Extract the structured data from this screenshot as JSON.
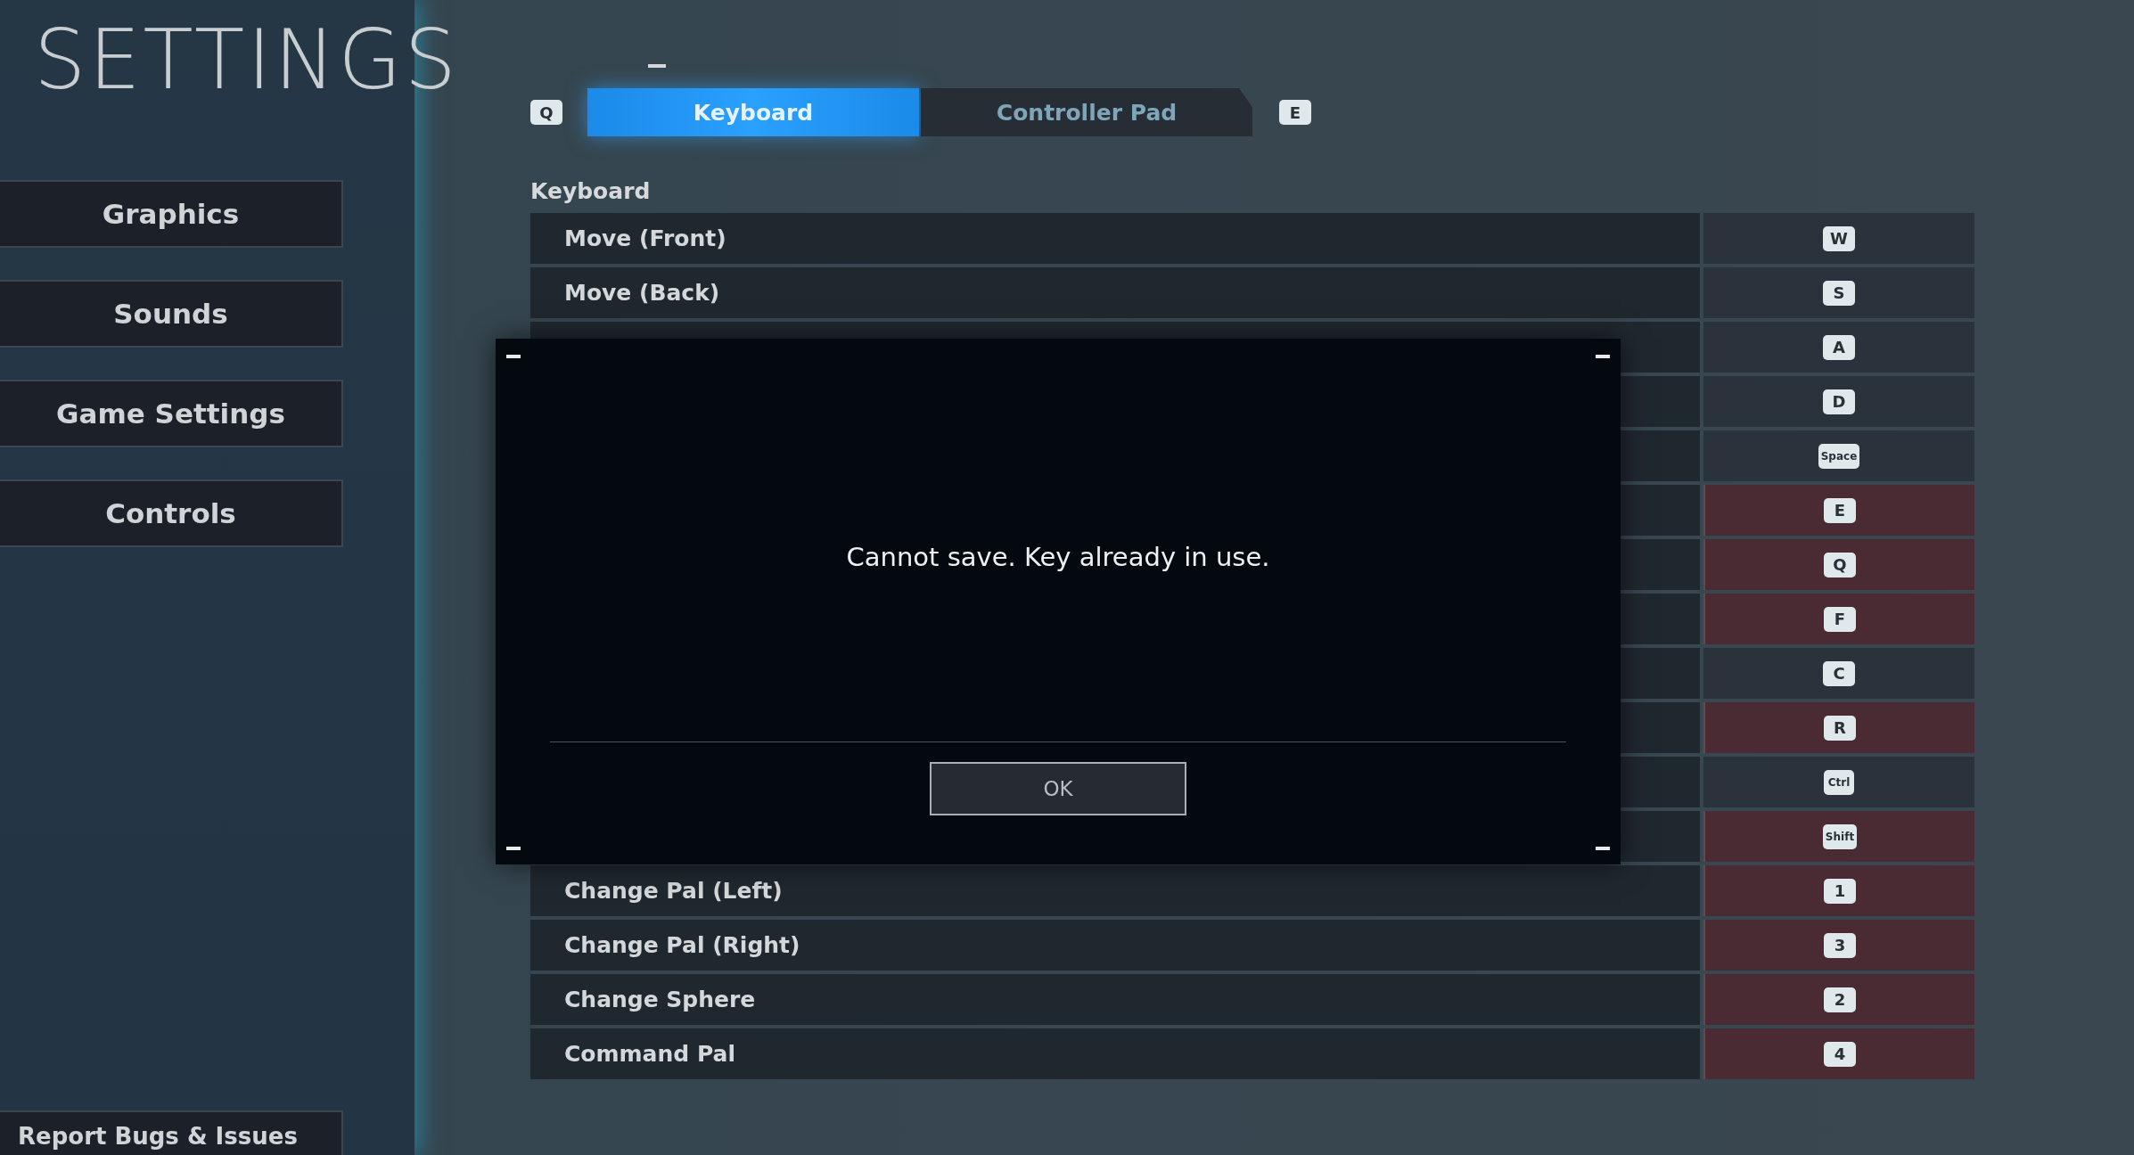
{
  "title": "SETTINGS",
  "menu": [
    {
      "label": "Graphics"
    },
    {
      "label": "Sounds"
    },
    {
      "label": "Game Settings"
    },
    {
      "label": "Controls"
    }
  ],
  "report_button": "Report Bugs & Issues",
  "tab_keys": {
    "prev": "Q",
    "next": "E"
  },
  "tabs": [
    {
      "label": "Keyboard",
      "selected": true
    },
    {
      "label": "Controller Pad",
      "selected": false
    }
  ],
  "section_heading": "Keyboard",
  "bindings": [
    {
      "action": "Move (Front)",
      "key": "W",
      "conflict": false
    },
    {
      "action": "Move (Back)",
      "key": "S",
      "conflict": false
    },
    {
      "key": "A",
      "conflict": false
    },
    {
      "key": "D",
      "conflict": false
    },
    {
      "key": "Space",
      "conflict": false
    },
    {
      "key": "E",
      "conflict": true
    },
    {
      "key": "Q",
      "conflict": true
    },
    {
      "key": "F",
      "conflict": true
    },
    {
      "key": "C",
      "conflict": false
    },
    {
      "key": "R",
      "conflict": true
    },
    {
      "key": "Ctrl",
      "conflict": false
    },
    {
      "key": "Shift",
      "conflict": true
    },
    {
      "action": "Change Pal (Left)",
      "key": "1",
      "conflict": true
    },
    {
      "action": "Change Pal (Right)",
      "key": "3",
      "conflict": true
    },
    {
      "action": "Change Sphere",
      "key": "2",
      "conflict": true
    },
    {
      "action": "Command Pal",
      "key": "4",
      "conflict": true
    }
  ],
  "dialog": {
    "message": "Cannot save. Key already in use.",
    "button": "OK"
  }
}
